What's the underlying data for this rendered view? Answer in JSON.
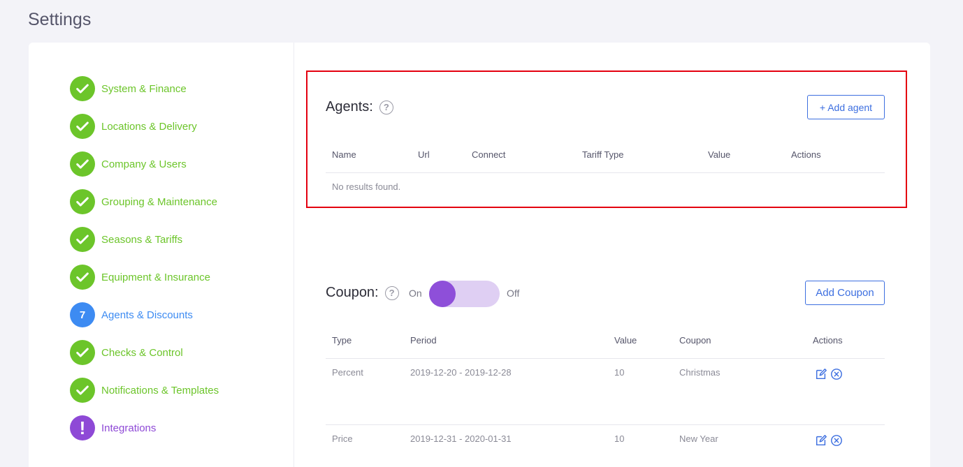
{
  "page": {
    "title": "Settings"
  },
  "steps": [
    {
      "label": "System & Finance",
      "state": "done",
      "badge": ""
    },
    {
      "label": "Locations & Delivery",
      "state": "done",
      "badge": ""
    },
    {
      "label": "Company & Users",
      "state": "done",
      "badge": ""
    },
    {
      "label": "Grouping & Maintenance",
      "state": "done",
      "badge": ""
    },
    {
      "label": "Seasons & Tariffs",
      "state": "done",
      "badge": ""
    },
    {
      "label": "Equipment & Insurance",
      "state": "done",
      "badge": ""
    },
    {
      "label": "Agents & Discounts",
      "state": "active",
      "badge": "7"
    },
    {
      "label": "Checks & Control",
      "state": "done",
      "badge": ""
    },
    {
      "label": "Notifications & Templates",
      "state": "done",
      "badge": ""
    },
    {
      "label": "Integrations",
      "state": "warning",
      "badge": "!"
    }
  ],
  "agents": {
    "title": "Agents:",
    "help": "?",
    "add_button": "+ Add agent",
    "columns": [
      "Name",
      "Url",
      "Connect",
      "Tariff Type",
      "Value",
      "Actions"
    ],
    "empty_text": "No results found."
  },
  "coupon": {
    "title": "Coupon:",
    "help": "?",
    "toggle_on_label": "On",
    "toggle_off_label": "Off",
    "add_button": "Add Coupon",
    "columns": [
      "Type",
      "Period",
      "Value",
      "Coupon",
      "Actions"
    ],
    "rows": [
      {
        "type": "Percent",
        "period": "2019-12-20 - 2019-12-28",
        "value": "10",
        "coupon": "Christmas"
      },
      {
        "type": "Price",
        "period": "2019-12-31 - 2020-01-31",
        "value": "10",
        "coupon": "New Year"
      }
    ]
  },
  "colors": {
    "done": "#6cc52a",
    "active": "#3d8bf2",
    "warning": "#8e49d6",
    "accent_button": "#3d6fe0",
    "highlight_border": "#e4000f",
    "toggle_knob": "#8e4fd9",
    "toggle_track": "#dfcff3"
  },
  "icons": {
    "done": "check-icon",
    "edit": "edit-icon",
    "delete": "close-circle-icon",
    "help": "question-circle-icon"
  }
}
